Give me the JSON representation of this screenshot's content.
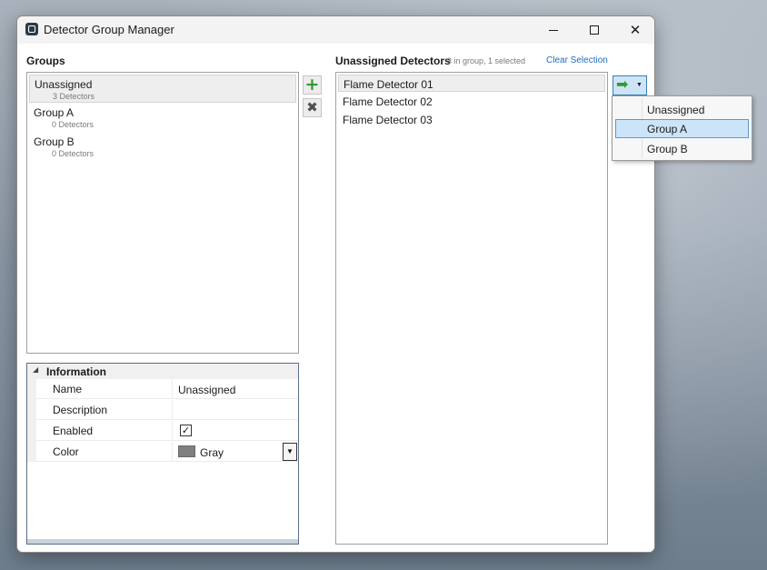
{
  "window": {
    "title": "Detector Group Manager",
    "controls": {
      "minimize": "minimize",
      "maximize": "maximize",
      "close": "✕"
    }
  },
  "groups": {
    "label": "Groups",
    "items": [
      {
        "name": "Unassigned",
        "count": "3 Detectors",
        "selected": true
      },
      {
        "name": "Group A",
        "count": "0 Detectors",
        "selected": false
      },
      {
        "name": "Group B",
        "count": "0 Detectors",
        "selected": false
      }
    ],
    "add_icon": "plus-icon",
    "remove_icon": "x-icon"
  },
  "information": {
    "title": "Information",
    "properties": {
      "name_label": "Name",
      "name_value": "Unassigned",
      "description_label": "Description",
      "description_value": "",
      "enabled_label": "Enabled",
      "enabled_value": true,
      "enabled_mark": "✓",
      "color_label": "Color",
      "color_value": "Gray",
      "color_hex": "#808080"
    }
  },
  "unassigned": {
    "title": "Unassigned Detectors",
    "info": "3 in group, 1 selected",
    "clear_label": "Clear Selection",
    "detectors": [
      {
        "name": "Flame Detector 01",
        "selected": true
      },
      {
        "name": "Flame Detector 02",
        "selected": false
      },
      {
        "name": "Flame Detector 03",
        "selected": false
      }
    ]
  },
  "move_menu": {
    "button_icon": "arrow-right-icon",
    "options": [
      {
        "label": "Unassigned",
        "highlighted": false
      },
      {
        "label": "Group A",
        "highlighted": true
      },
      {
        "label": "Group B",
        "highlighted": false
      }
    ]
  },
  "colors": {
    "link": "#1f6bbf",
    "accent_green": "#2f9a2f",
    "highlight": "#cce4f7"
  }
}
